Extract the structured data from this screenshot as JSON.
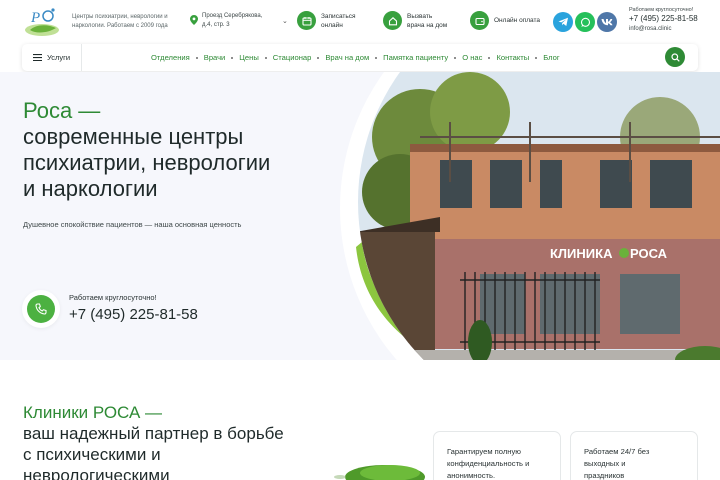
{
  "header": {
    "tagline": "Центры психиатрии, неврологии и наркологии. Работаем с 2009 года",
    "address": "Проезд Серебрякова, д.4, стр. 3",
    "book_online": "Записаться онлайн",
    "home_visit": "Вызвать врача на дом",
    "online_payment": "Онлайн оплата",
    "hours": "Работаем круглосуточно!",
    "phone": "+7 (495) 225-81-58",
    "email": "info@rosa.clinic"
  },
  "nav": {
    "services": "Услуги",
    "items": [
      "Отделения",
      "Врачи",
      "Цены",
      "Стационар",
      "Врач на дом",
      "Памятка пациенту",
      "О нас",
      "Контакты",
      "Блог"
    ]
  },
  "hero": {
    "brand": "Роса —",
    "title_line1": "современные центры",
    "title_line2": "психиатрии, неврологии",
    "title_line3": "и наркологии",
    "subtitle": "Душевное спокойствие пациентов — наша основная ценность",
    "hours": "Работаем круглосуточно!",
    "phone": "+7 (495) 225-81-58",
    "sign_text": "КЛИНИКА",
    "sign_brand": "РОСА"
  },
  "section2": {
    "brand": "Клиники РОСА —",
    "line1": "ваш надежный партнер в борьбе",
    "line2": "с психическими и",
    "line3": "неврологическими",
    "card1_line1": "Гарантируем полную",
    "card1_line2": "конфиденциальность и",
    "card1_line3": "анонимность.",
    "card2_line1": "Работаем 24/7 без",
    "card2_line2": "выходных и",
    "card2_line3": "праздников"
  },
  "colors": {
    "brand_green": "#2e8a35",
    "accent_green": "#4cb141",
    "telegram": "#2aa3dd",
    "whatsapp": "#25c05a",
    "vk": "#4f77a8",
    "hero_bg": "#f6f7fc"
  },
  "icons": [
    "logo-icon",
    "location-pin-icon",
    "chevron-down-icon",
    "calendar-icon",
    "house-icon",
    "wallet-icon",
    "telegram-icon",
    "whatsapp-icon",
    "vk-icon",
    "hamburger-icon",
    "search-icon",
    "phone-icon"
  ]
}
